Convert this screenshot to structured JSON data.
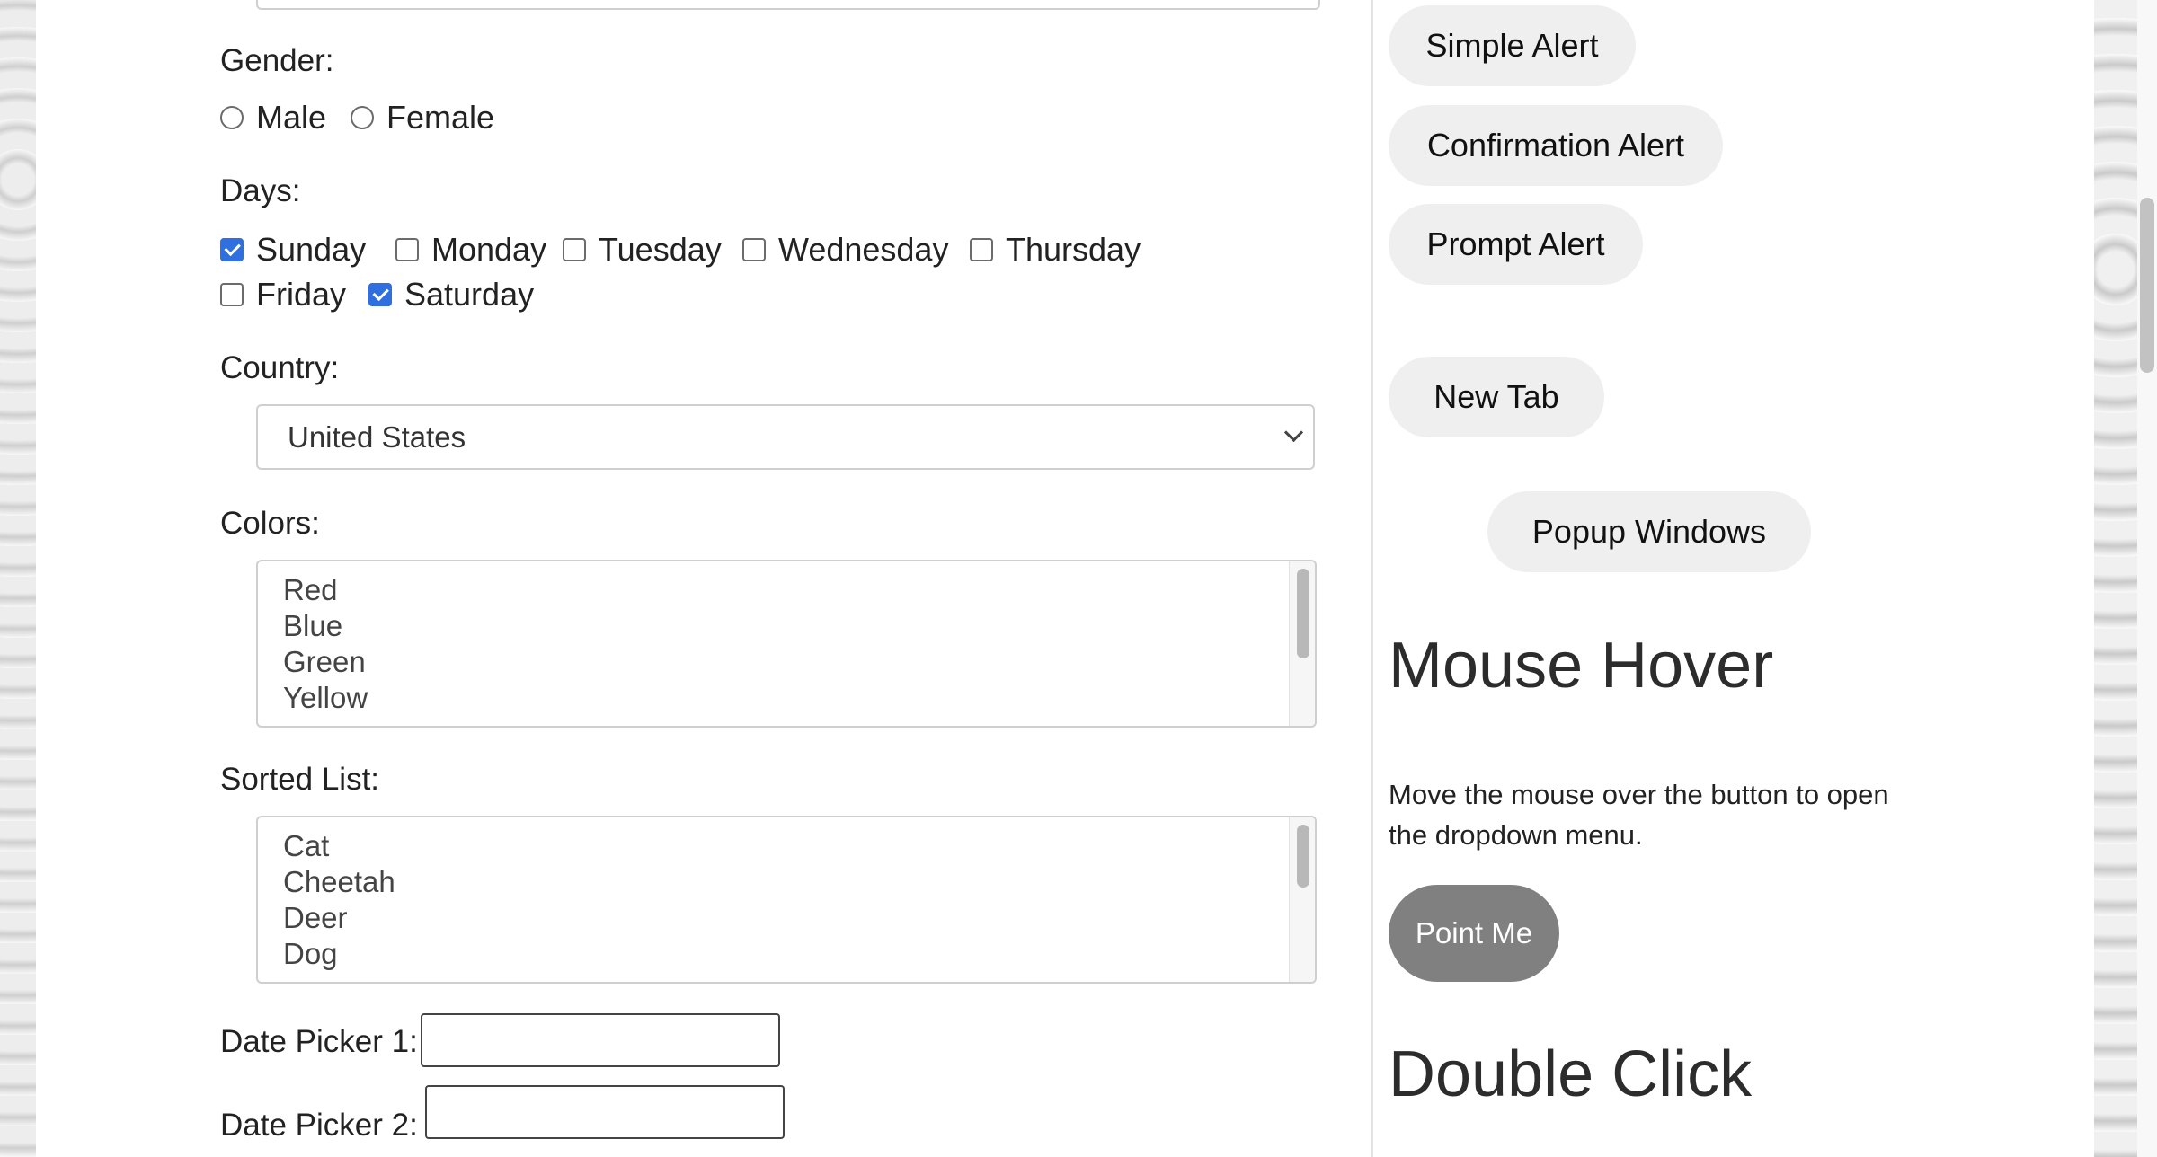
{
  "form": {
    "gender_label": "Gender:",
    "gender_options": [
      "Male",
      "Female"
    ],
    "days_label": "Days:",
    "days": [
      "Sunday",
      "Monday",
      "Tuesday",
      "Wednesday",
      "Thursday",
      "Friday",
      "Saturday"
    ],
    "days_checked": [
      "Sunday",
      "Saturday"
    ],
    "country_label": "Country:",
    "country_selected": "United States",
    "colors_label": "Colors:",
    "colors_visible": [
      "Red",
      "Blue",
      "Green",
      "Yellow"
    ],
    "sorted_label": "Sorted List:",
    "sorted_visible": [
      "Cat",
      "Cheetah",
      "Deer",
      "Dog"
    ],
    "date_picker_1_label": "Date Picker 1:",
    "date_picker_2_label": "Date Picker 2:"
  },
  "sidebar": {
    "simple_alert": "Simple Alert",
    "confirmation_alert": "Confirmation Alert",
    "prompt_alert": "Prompt Alert",
    "new_tab": "New Tab",
    "popup_windows": "Popup Windows",
    "mouse_hover_title": "Mouse Hover",
    "mouse_hover_text": "Move the mouse over the button to open the dropdown menu.",
    "point_me": "Point Me",
    "double_click_title": "Double Click"
  }
}
